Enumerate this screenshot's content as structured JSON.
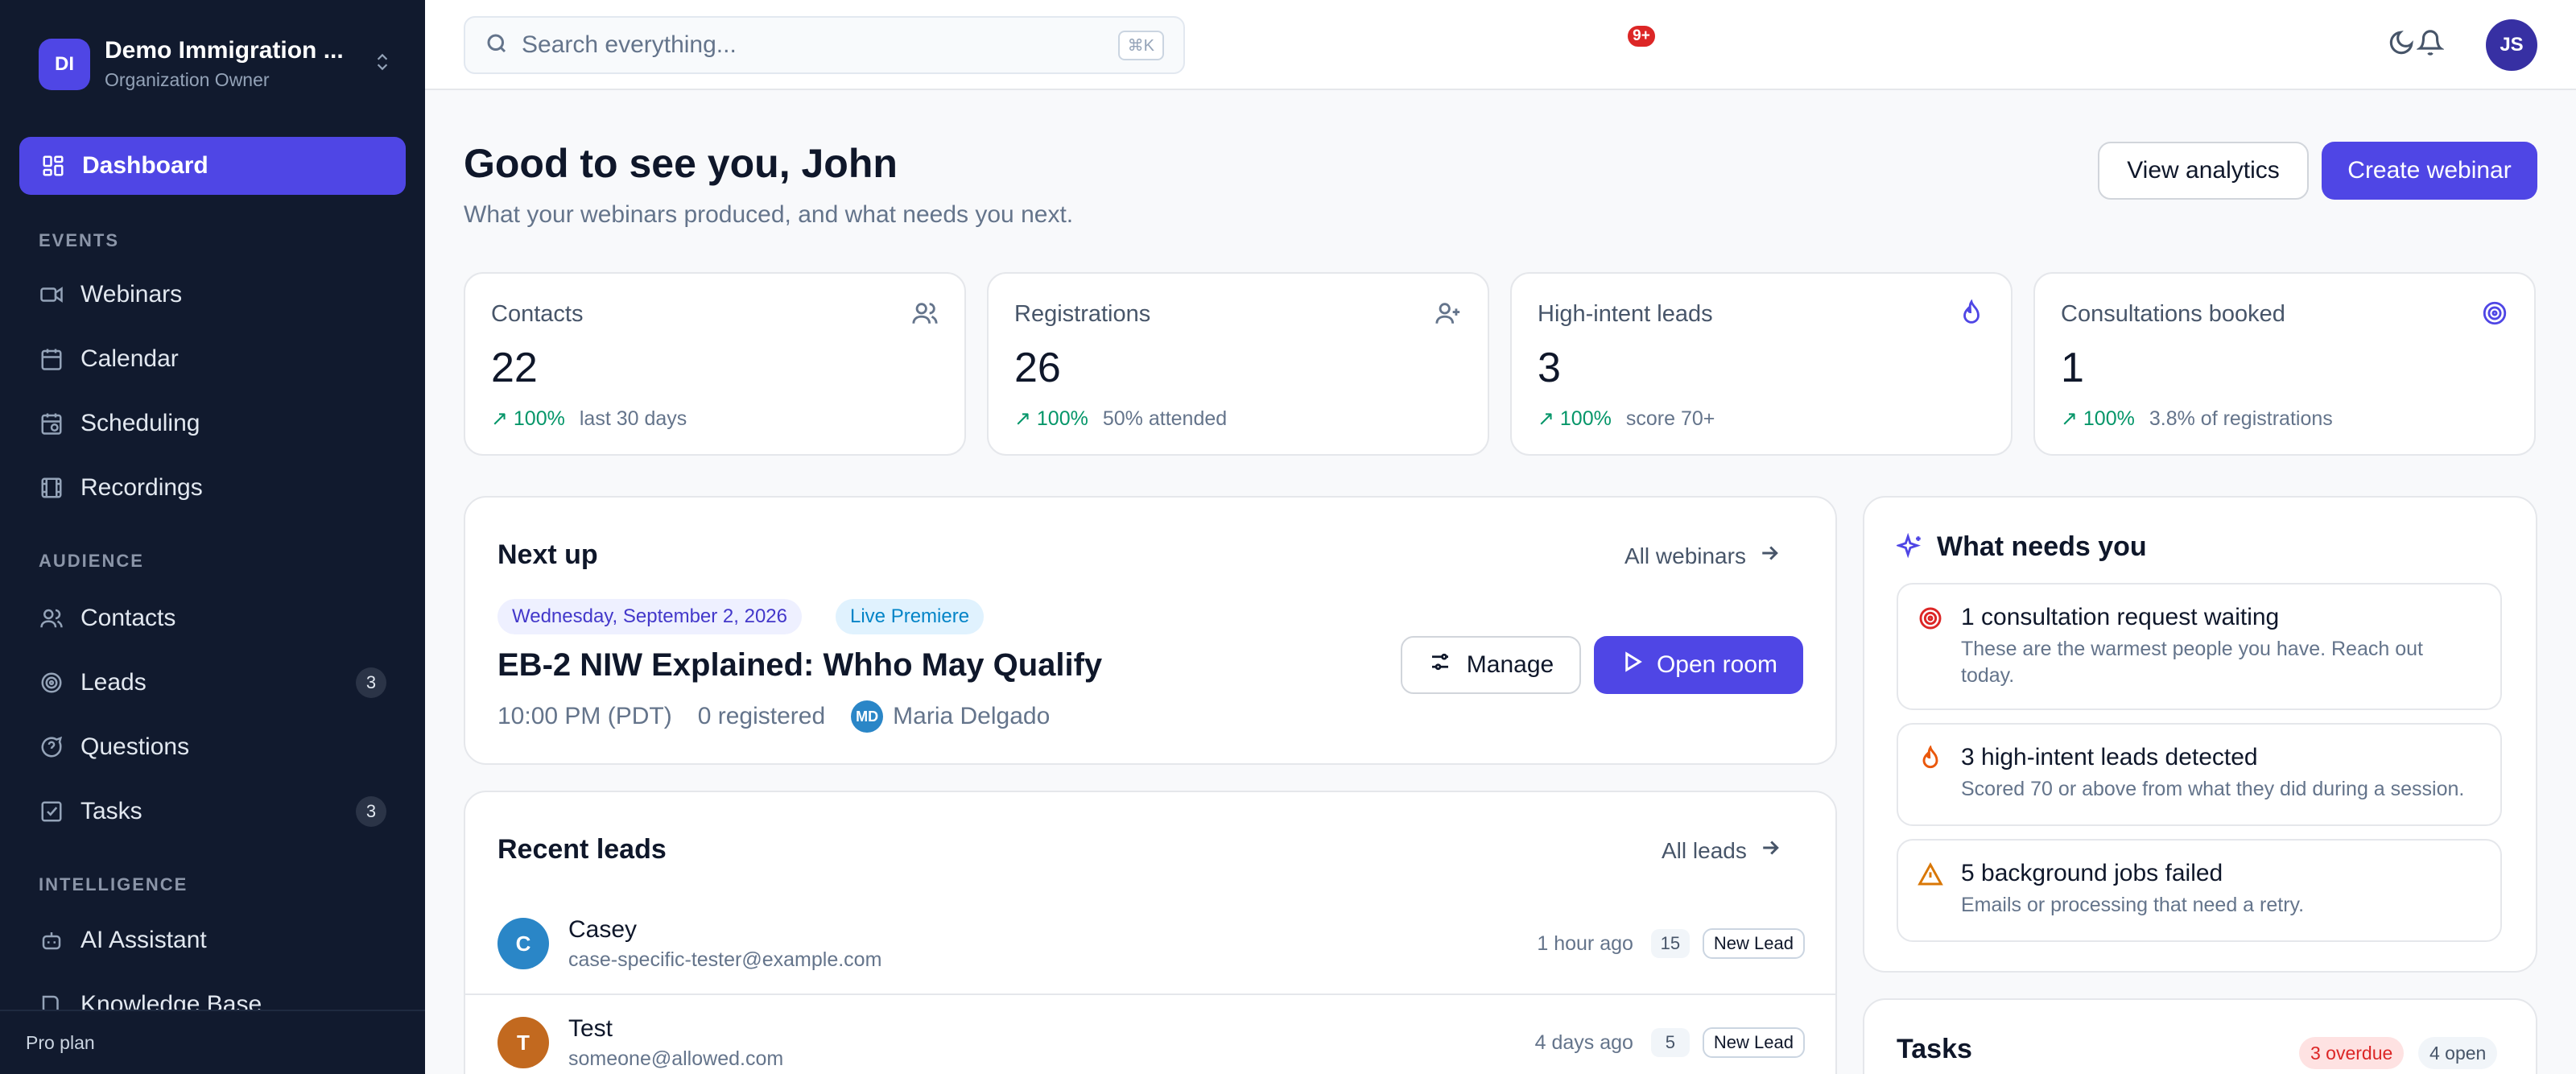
{
  "org": {
    "initials": "DI",
    "name": "Demo Immigration ...",
    "role": "Organization Owner"
  },
  "nav": {
    "dashboard": "Dashboard",
    "events_label": "EVENTS",
    "webinars": "Webinars",
    "calendar": "Calendar",
    "scheduling": "Scheduling",
    "recordings": "Recordings",
    "audience_label": "AUDIENCE",
    "contacts": "Contacts",
    "leads": "Leads",
    "leads_count": "3",
    "questions": "Questions",
    "tasks": "Tasks",
    "tasks_count": "3",
    "intelligence_label": "INTELLIGENCE",
    "ai_assistant": "AI Assistant",
    "knowledge_base": "Knowledge Base",
    "plan": "Pro plan"
  },
  "topbar": {
    "search_placeholder": "Search everything...",
    "shortcut": "⌘K",
    "notifications": "9+",
    "user_initials": "JS"
  },
  "header": {
    "greeting": "Good to see you, John",
    "subtitle": "What your webinars produced, and what needs you next.",
    "view_analytics": "View analytics",
    "create_webinar": "Create webinar"
  },
  "stats": [
    {
      "label": "Contacts",
      "value": "22",
      "change": "100%",
      "note": "last 30 days",
      "icon": "users-icon"
    },
    {
      "label": "Registrations",
      "value": "26",
      "change": "100%",
      "note": "50% attended",
      "icon": "user-plus-icon"
    },
    {
      "label": "High-intent leads",
      "value": "3",
      "change": "100%",
      "note": "score 70+",
      "icon": "flame-icon"
    },
    {
      "label": "Consultations booked",
      "value": "1",
      "change": "100%",
      "note": "3.8% of registrations",
      "icon": "target-icon"
    }
  ],
  "next_up": {
    "title": "Next up",
    "link": "All webinars",
    "date": "Wednesday, September 2, 2026",
    "type": "Live Premiere",
    "webinar_title": "EB-2 NIW Explained: Whho May Qualify",
    "time": "10:00 PM (PDT)",
    "registered": "0 registered",
    "host_initials": "MD",
    "host": "Maria Delgado",
    "manage": "Manage",
    "open_room": "Open room"
  },
  "recent_leads": {
    "title": "Recent leads",
    "link": "All leads",
    "items": [
      {
        "initial": "C",
        "name": "Casey",
        "email": "case-specific-tester@example.com",
        "time": "1 hour ago",
        "score": "15",
        "status": "New Lead",
        "color": "#2a86c7"
      },
      {
        "initial": "T",
        "name": "Test",
        "email": "someone@allowed.com",
        "time": "4 days ago",
        "score": "5",
        "status": "New Lead",
        "color": "#c2691f"
      }
    ]
  },
  "needs": {
    "title": "What needs you",
    "items": [
      {
        "title": "1 consultation request waiting",
        "desc": "These are the warmest people you have. Reach out today.",
        "icon": "target-icon",
        "color": "#dc2626"
      },
      {
        "title": "3 high-intent leads detected",
        "desc": "Scored 70 or above from what they did during a session.",
        "icon": "flame-icon",
        "color": "#ea580c"
      },
      {
        "title": "5 background jobs failed",
        "desc": "Emails or processing that need a retry.",
        "icon": "warning-icon",
        "color": "#d97706"
      }
    ]
  },
  "tasks": {
    "title": "Tasks",
    "overdue": "3 overdue",
    "open": "4 open"
  },
  "colors": {
    "accent": "#4f46e5",
    "sidebar": "#111a2e",
    "positive": "#059669"
  }
}
